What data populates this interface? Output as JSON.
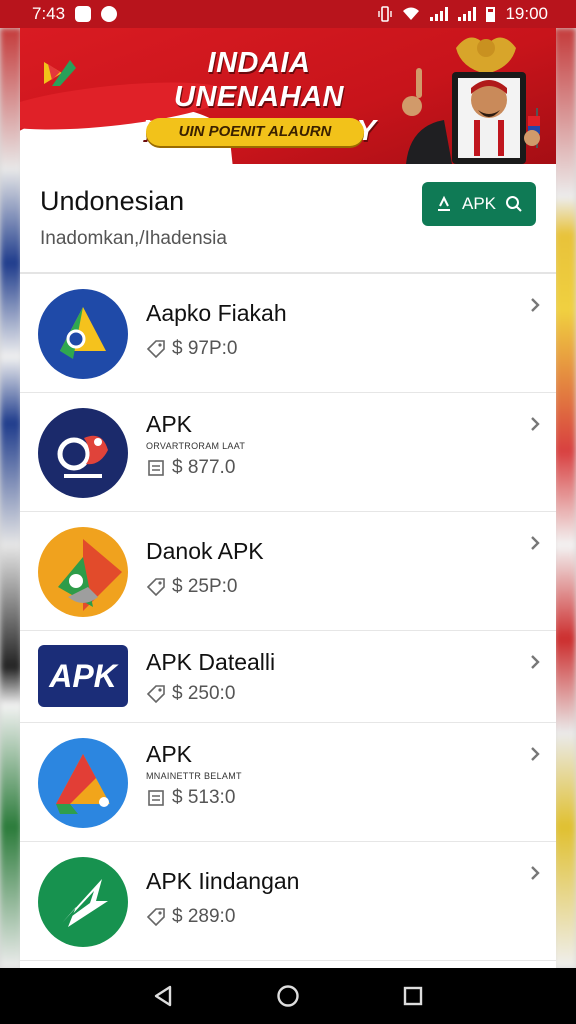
{
  "status_bar": {
    "time_left": "7:43",
    "time_right": "19:00",
    "icons": [
      "notification-icon",
      "telegram-icon",
      "vibrate-icon",
      "wifi-icon",
      "signal-icon",
      "battery-icon"
    ]
  },
  "banner": {
    "title": "INDAIA UNENAHAN INNARAKA AIPY",
    "pill": "UIN POENIT ALAURN",
    "colors": {
      "red": "#d91b22",
      "gold": "#f2c21a"
    }
  },
  "header": {
    "title": "Undonesian",
    "subtitle": "Inadomkan,/Ihadensia",
    "button_label": "APK"
  },
  "apps": [
    {
      "name": "Aapko Fiakah",
      "tagline": "",
      "price": "$ 97P:0",
      "icon": "triangle-green-icon"
    },
    {
      "name": "APK",
      "tagline": "ORVARTRORAM LAAT",
      "price": "$ 877.0",
      "icon": "fox-badge-icon"
    },
    {
      "name": "Danok APK",
      "tagline": "",
      "price": "$ 25P:0",
      "icon": "orange-play-icon"
    },
    {
      "name": "APK Datealli",
      "tagline": "",
      "price": "$ 250:0",
      "icon": "apk-logo-icon"
    },
    {
      "name": "APK",
      "tagline": "MNAINETTR BELAMT",
      "price": "$ 513:0",
      "icon": "blue-triangle-icon"
    },
    {
      "name": "APK Iindangan",
      "tagline": "",
      "price": "$ 289:0",
      "icon": "green-arrow-icon"
    }
  ],
  "accent_color": "#0f7a55"
}
